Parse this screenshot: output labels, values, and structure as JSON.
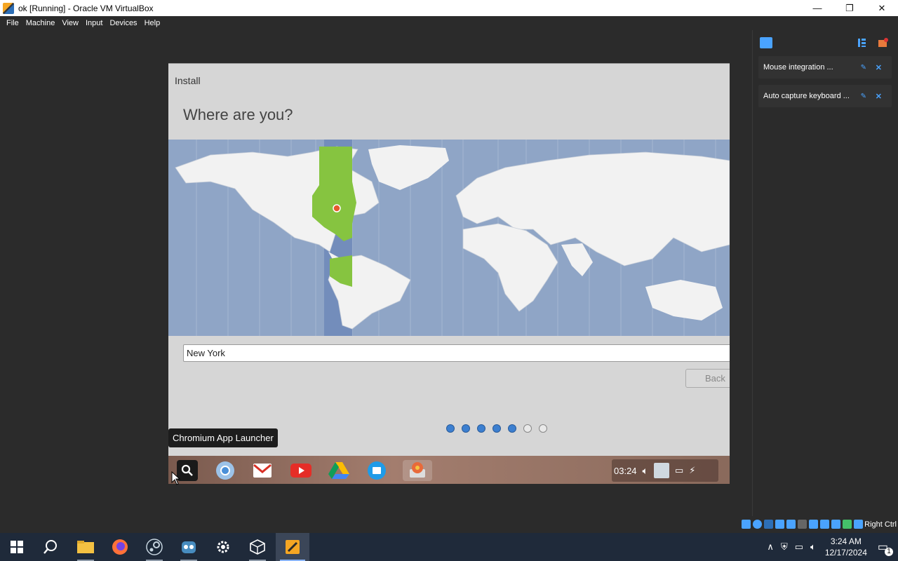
{
  "window": {
    "title": "ok [Running] - Oracle VM VirtualBox",
    "minimize": "—",
    "restore": "❐",
    "close": "✕"
  },
  "menu": [
    "File",
    "Machine",
    "View",
    "Input",
    "Devices",
    "Help"
  ],
  "notifications": [
    {
      "text": "Mouse integration ..."
    },
    {
      "text": "Auto capture keyboard ..."
    }
  ],
  "status": {
    "host_key": "Right Ctrl"
  },
  "guest": {
    "install_label": "Install",
    "heading": "Where are you?",
    "city_value": "New York",
    "back_label": "Back",
    "progress_dots": {
      "filled": 5,
      "total": 7
    },
    "tooltip": "Chromium App Launcher",
    "shelf_clock": "03:24"
  },
  "taskbar": {
    "time": "3:24 AM",
    "date": "12/17/2024",
    "notification_count": "1"
  },
  "colors": {
    "map_ocean": "#8fa5c6",
    "land": "#f2f2f2",
    "timezone_highlight": "#86c440",
    "accent_blue": "#3c7fd0"
  }
}
